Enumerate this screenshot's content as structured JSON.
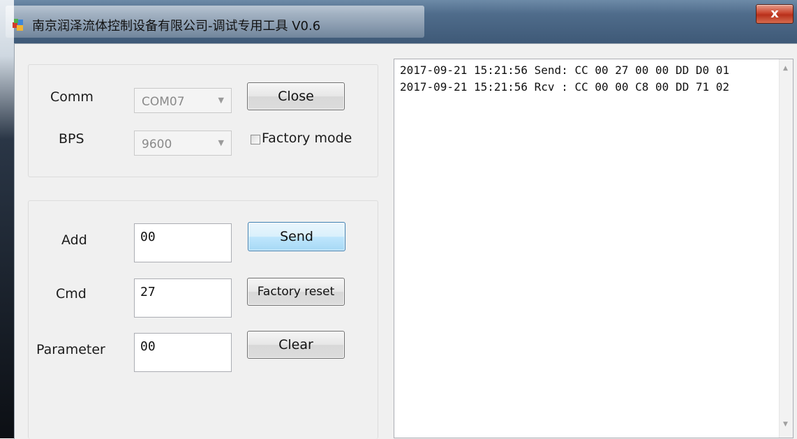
{
  "window": {
    "title": "南京润泽流体控制设备有限公司-调试专用工具 V0.6",
    "close_label": "x"
  },
  "serial": {
    "comm_label": "Comm",
    "comm_value": "COM07",
    "bps_label": "BPS",
    "bps_value": "9600",
    "close_button": "Close",
    "factory_mode_label": "Factory mode",
    "factory_mode_checked": false
  },
  "command": {
    "add_label": "Add",
    "add_value": "00",
    "cmd_label": "Cmd",
    "cmd_value": "27",
    "parameter_label": "Parameter",
    "parameter_value": "00",
    "send_button": "Send",
    "factory_reset_button": "Factory reset",
    "clear_button": "Clear"
  },
  "log": {
    "lines": [
      "2017-09-21 15:21:56 Send: CC 00 27 00 00 DD D0 01",
      "2017-09-21 15:21:56 Rcv : CC 00 00 C8 00 DD 71 02"
    ]
  }
}
